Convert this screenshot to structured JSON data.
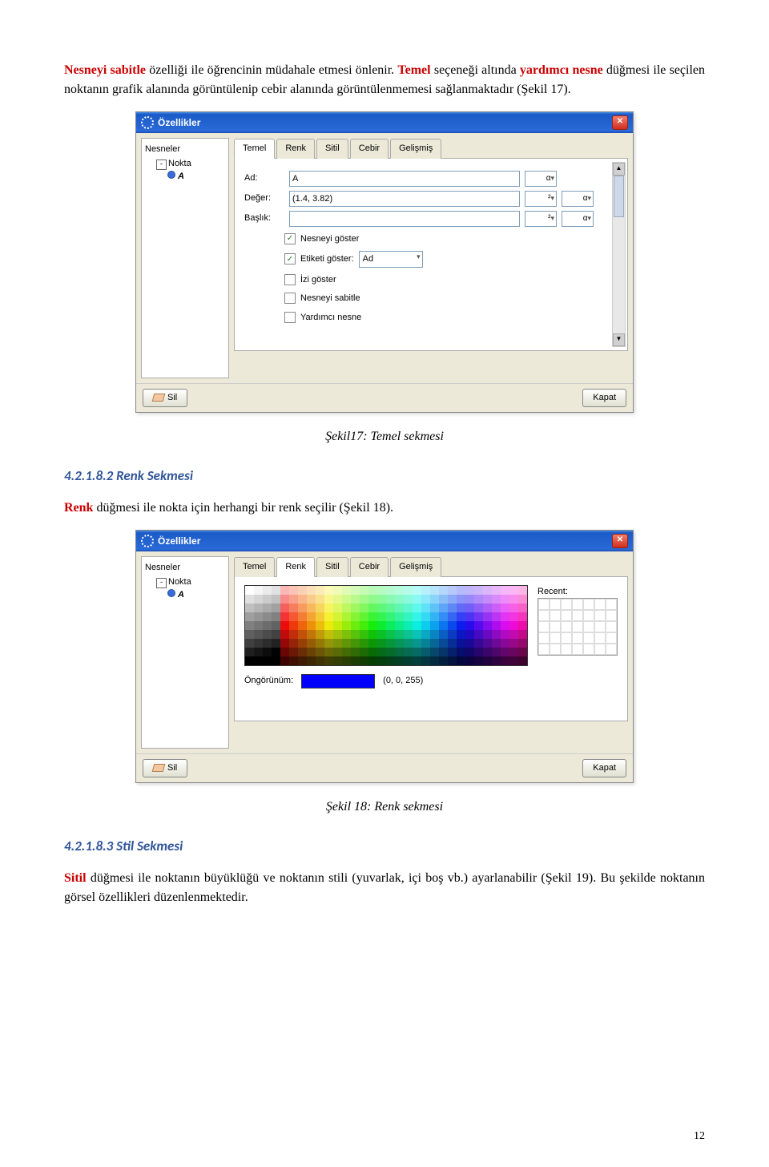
{
  "intro": {
    "span1a": "Nesneyi sabitle",
    "span1b": " özelliği ile öğrencinin müdahale etmesi önlenir. ",
    "span1c": "Temel",
    "span1d": " seçeneği altında ",
    "span1e": "yardımcı nesne",
    "span1f": " düğmesi ile seçilen noktanın grafik alanında görüntülenip cebir alanında görüntülenmemesi sağlanmaktadır (Şekil 17)."
  },
  "dialog1": {
    "title": "Özellikler",
    "tree_root": "Nesneler",
    "tree_child": "Nokta",
    "tree_leaf": "A",
    "tabs": [
      "Temel",
      "Renk",
      "Sitil",
      "Cebir",
      "Gelişmiş"
    ],
    "ad_label": "Ad:",
    "ad_value": "A",
    "deger_label": "Değer:",
    "deger_value": "(1.4, 3.82)",
    "baslik_label": "Başlık:",
    "baslik_value": "",
    "alpha": "α",
    "sq": "²",
    "chk1": "Nesneyi göster",
    "chk2": "Etiketi göster:",
    "chk2_sel": "Ad",
    "chk3": "İzi göster",
    "chk4": "Nesneyi sabitle",
    "chk5": "Yardımcı nesne",
    "btn_sil": "Sil",
    "btn_kapat": "Kapat"
  },
  "caption1": "Şekil17: Temel sekmesi",
  "heading2": "4.2.1.8.2 Renk Sekmesi",
  "para2a": "Renk",
  "para2b": " düğmesi ile nokta için herhangi bir renk seçilir (Şekil 18).",
  "dialog2": {
    "title": "Özellikler",
    "tree_root": "Nesneler",
    "tree_child": "Nokta",
    "tree_leaf": "A",
    "tabs": [
      "Temel",
      "Renk",
      "Sitil",
      "Cebir",
      "Gelişmiş"
    ],
    "recent_label": "Recent:",
    "preview_label": "Öngörünüm:",
    "preview_val": "(0, 0, 255)",
    "btn_sil": "Sil",
    "btn_kapat": "Kapat"
  },
  "caption2": "Şekil 18: Renk sekmesi",
  "heading3": "4.2.1.8.3 Stil Sekmesi",
  "para3a": "Sitil",
  "para3b": " düğmesi ile noktanın büyüklüğü ve noktanın stili (yuvarlak, içi boş vb.) ayarlanabilir (Şekil 19). Bu şekilde noktanın görsel özellikleri düzenlenmektedir.",
  "page_num": "12"
}
